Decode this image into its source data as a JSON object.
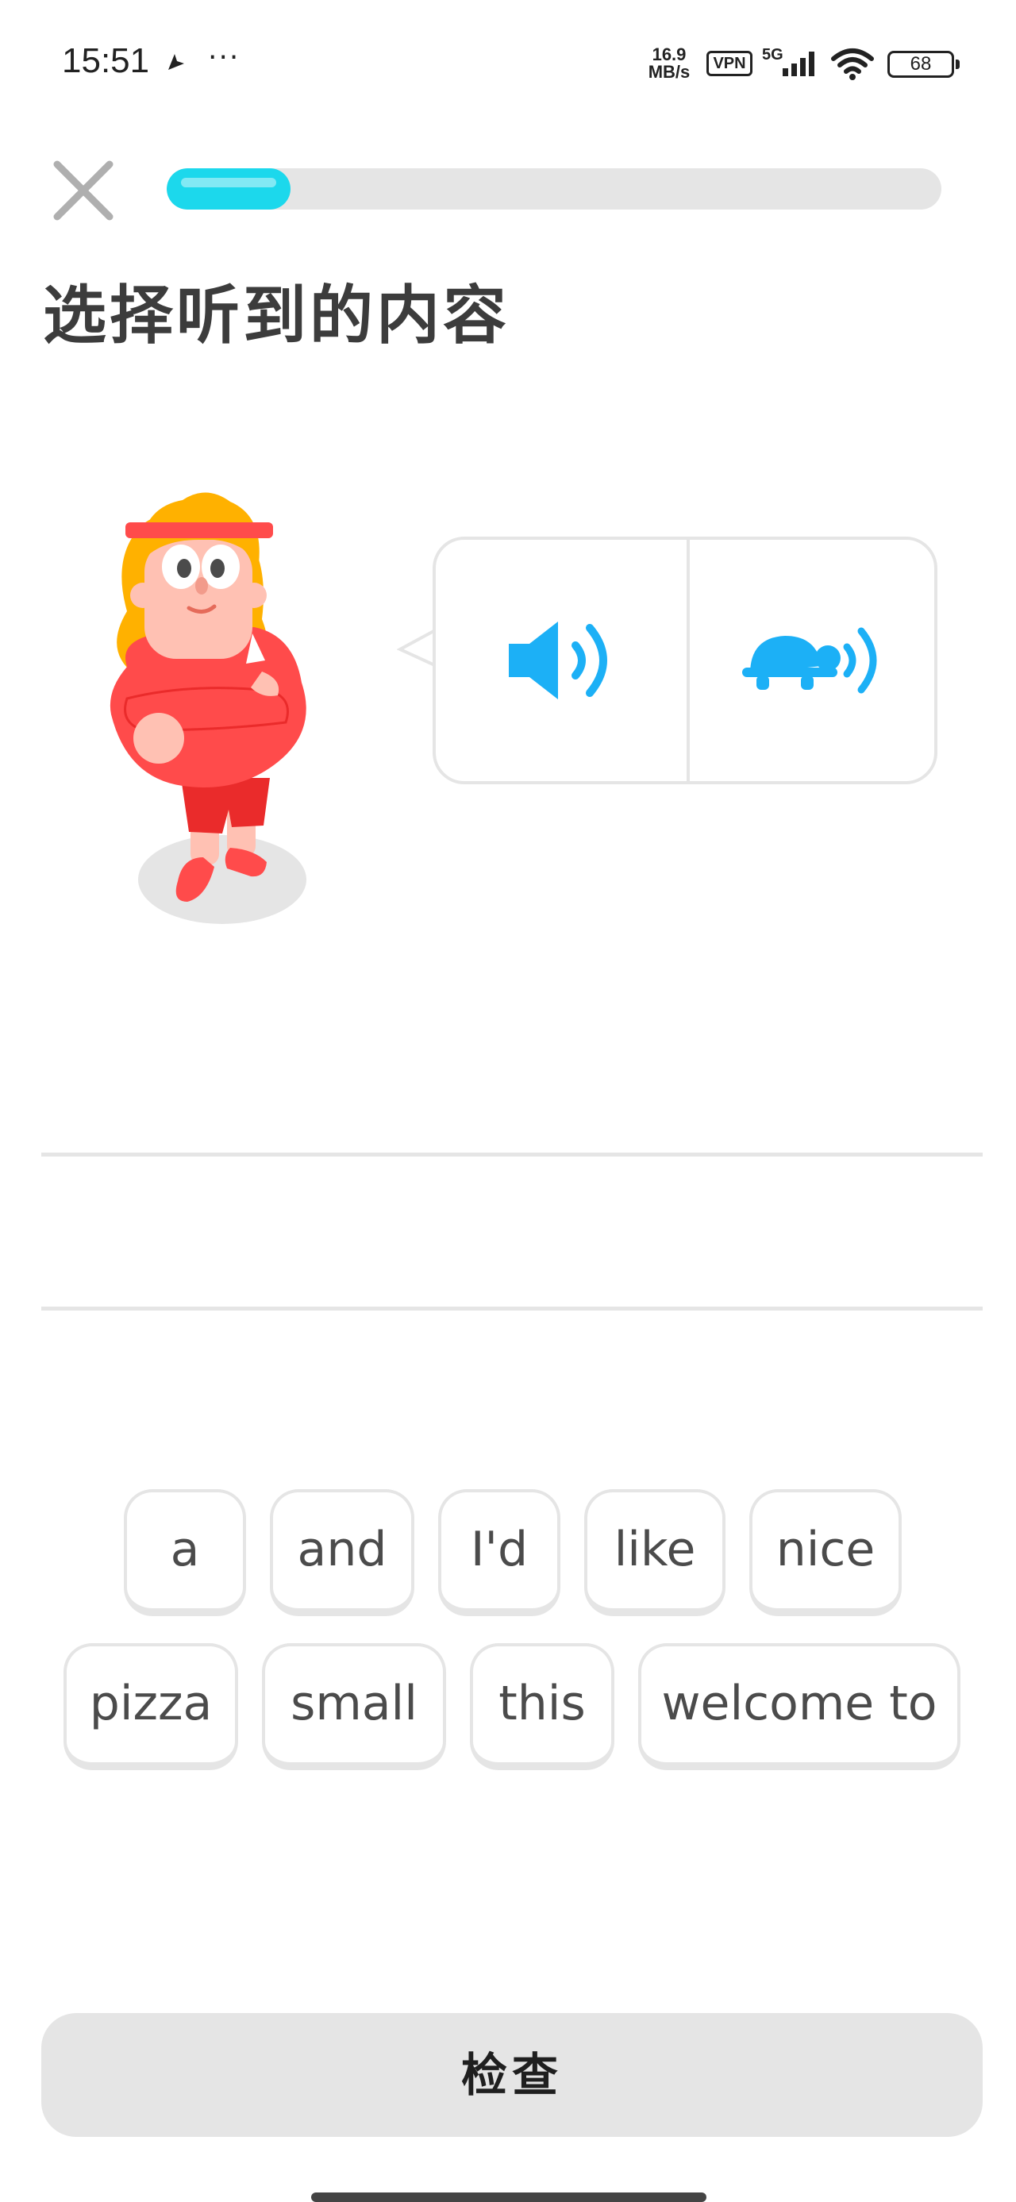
{
  "status_bar": {
    "time": "15:51",
    "dots": "···",
    "network_speed": "16.9 MB/s",
    "vpn": "VPN",
    "network_type": "5G",
    "battery": "68"
  },
  "header": {
    "progress_fraction": 0.16
  },
  "prompt": {
    "title": "选择听到的内容"
  },
  "audio": {
    "normal_icon": "speaker-icon",
    "slow_icon": "turtle-icon"
  },
  "word_bank": {
    "words": [
      "a",
      "and",
      "I'd",
      "like",
      "nice",
      "pizza",
      "small",
      "this",
      "welcome to"
    ]
  },
  "footer": {
    "check_label": "检查"
  },
  "colors": {
    "progress": "#1cd8ec",
    "audio_blue": "#1cb0f6",
    "border": "#e5e5e5",
    "character_shirt": "#ff4b4b",
    "character_hair": "#ffb100"
  }
}
